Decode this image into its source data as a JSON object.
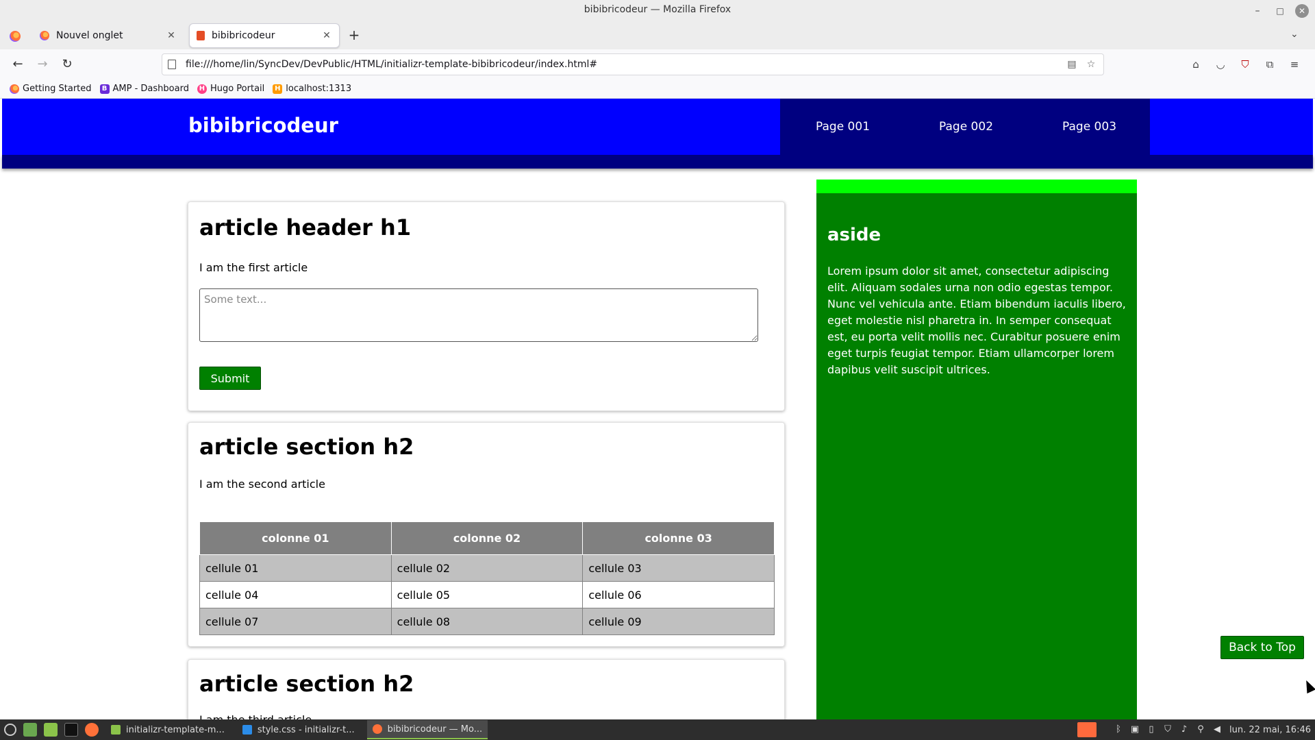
{
  "window": {
    "title": "bibibricodeur — Mozilla Firefox"
  },
  "tabs": [
    {
      "label": "Nouvel onglet"
    },
    {
      "label": "bibibricodeur"
    }
  ],
  "url": "file:///home/lin/SyncDev/DevPublic/HTML/initializr-template-bibibricodeur/index.html#",
  "bookmarks": [
    {
      "label": "Getting Started",
      "icon": "firefox-icon"
    },
    {
      "label": "AMP - Dashboard",
      "icon": "amp-icon",
      "glyph": "B"
    },
    {
      "label": "Hugo Portail",
      "icon": "hugo-icon",
      "glyph": "H"
    },
    {
      "label": "localhost:1313",
      "icon": "localhost-icon",
      "glyph": "H"
    }
  ],
  "site": {
    "title": "bibibricodeur",
    "nav": [
      "Page 001",
      "Page 002",
      "Page 003"
    ]
  },
  "article1": {
    "title": "article header h1",
    "text": "I am the first article",
    "textarea_placeholder": "Some text...",
    "submit_label": "Submit"
  },
  "article2": {
    "title": "article section h2",
    "text": "I am the second article",
    "table": {
      "headers": [
        "colonne 01",
        "colonne 02",
        "colonne 03"
      ],
      "rows": [
        [
          "cellule 01",
          "cellule 02",
          "cellule 03"
        ],
        [
          "cellule 04",
          "cellule 05",
          "cellule 06"
        ],
        [
          "cellule 07",
          "cellule 08",
          "cellule 09"
        ]
      ]
    }
  },
  "article3": {
    "title": "article section h2",
    "text": "I am the third article"
  },
  "aside": {
    "title": "aside",
    "text": "Lorem ipsum dolor sit amet, consectetur adipiscing elit. Aliquam sodales urna non odio egestas tempor. Nunc vel vehicula ante. Etiam bibendum iaculis libero, eget molestie nisl pharetra in. In semper consequat est, eu porta velit mollis nec. Curabitur posuere enim eget turpis feugiat tempor. Etiam ullamcorper lorem dapibus velit suscipit ultrices."
  },
  "back_to_top_label": "Back to Top",
  "taskbar": {
    "windows": [
      "initializr-template-m...",
      "style.css - initializr-t...",
      "bibibricodeur — Mo..."
    ],
    "clock": "lun. 22 mai, 16:46"
  },
  "colors": {
    "header_blue": "#0000ff",
    "nav_navy": "#000080",
    "aside_green": "#008000",
    "aside_accent": "#00ff00",
    "button_green": "#008000",
    "table_header": "#808080",
    "table_odd_row": "#c0c0c0"
  }
}
